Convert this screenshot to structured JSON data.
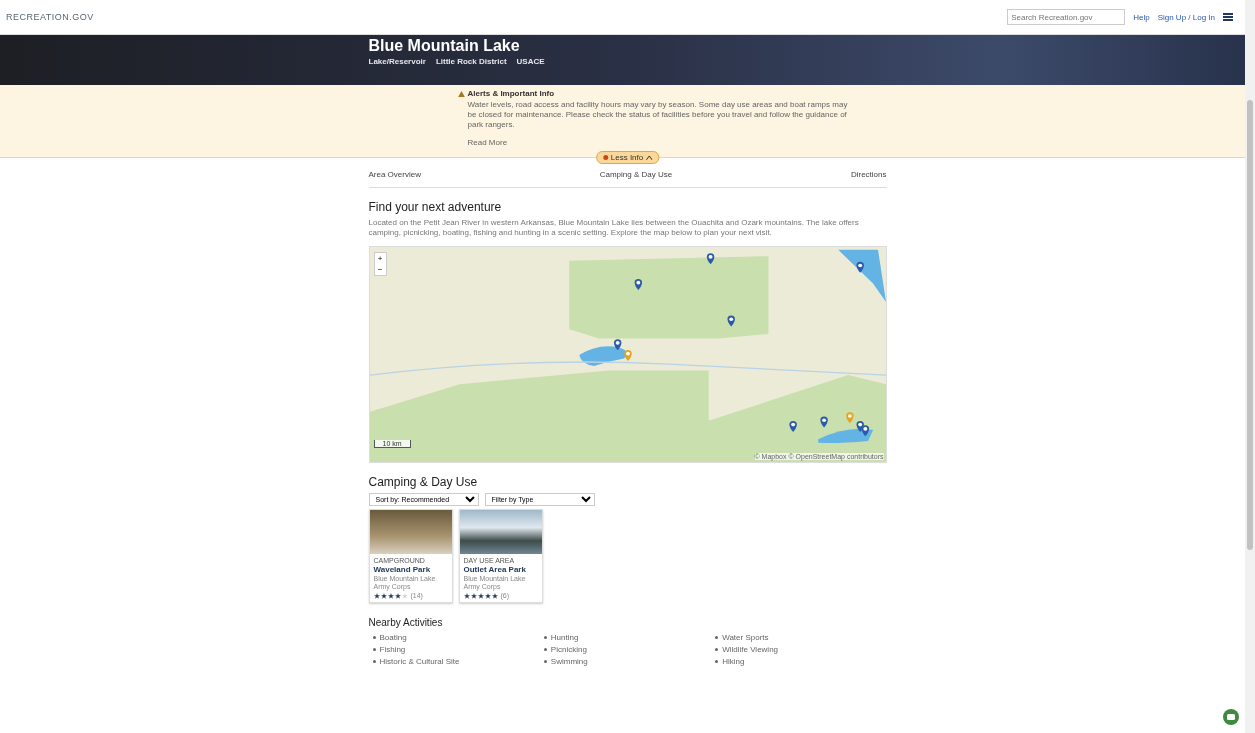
{
  "header": {
    "logo": "RECREATION.GOV",
    "search": {
      "placeholder": "Search Recreation.gov"
    },
    "links": [
      "Help",
      "Sign Up / Log In"
    ]
  },
  "hero": {
    "title": "Blue Mountain Lake",
    "breadcrumb": [
      "Lake/Reservoir",
      "Little Rock District",
      "USACE"
    ]
  },
  "alert": {
    "title": "Alerts & Important Info",
    "text": "Water levels, road access and facility hours may vary by season. Some day use areas and boat ramps may be closed for maintenance. Please check the status of facilities before you travel and follow the guidance of park rangers.",
    "more": "Read More",
    "toggle": "Less Info"
  },
  "tabs": [
    {
      "label": "Area Overview",
      "selected": false
    },
    {
      "label": "Camping & Day Use",
      "selected": false
    },
    {
      "label": "Directions",
      "selected": false
    }
  ],
  "adventure": {
    "title": "Find your next adventure",
    "text": "Located on the Petit Jean River in western Arkansas, Blue Mountain Lake lies between the Ouachita and Ozark mountains. The lake offers camping, picnicking, boating, fishing and hunting in a scenic setting. Explore the map below to plan your next visit."
  },
  "map": {
    "zoom": [
      "+",
      "−"
    ],
    "scale": "10 km",
    "attribution": "© Mapbox © OpenStreetMap contributors"
  },
  "camping": {
    "title": "Camping & Day Use",
    "filters": [
      "Sort by: Recommended",
      "Filter by Type"
    ],
    "cards": [
      {
        "category": "CAMPGROUND",
        "name": "Waveland Park",
        "location": "Blue Mountain Lake",
        "agency": "Army Corps",
        "stars": 4,
        "count": "(14)"
      },
      {
        "category": "DAY USE AREA",
        "name": "Outlet Area Park",
        "location": "Blue Mountain Lake",
        "agency": "Army Corps",
        "stars": 5,
        "count": "(6)"
      }
    ]
  },
  "activities": {
    "title": "Nearby Activities",
    "items": [
      "Boating",
      "Fishing",
      "Historic & Cultural Site",
      "Hunting",
      "Picnicking",
      "Swimming",
      "Water Sports",
      "Wildlife Viewing",
      "Hiking"
    ]
  }
}
